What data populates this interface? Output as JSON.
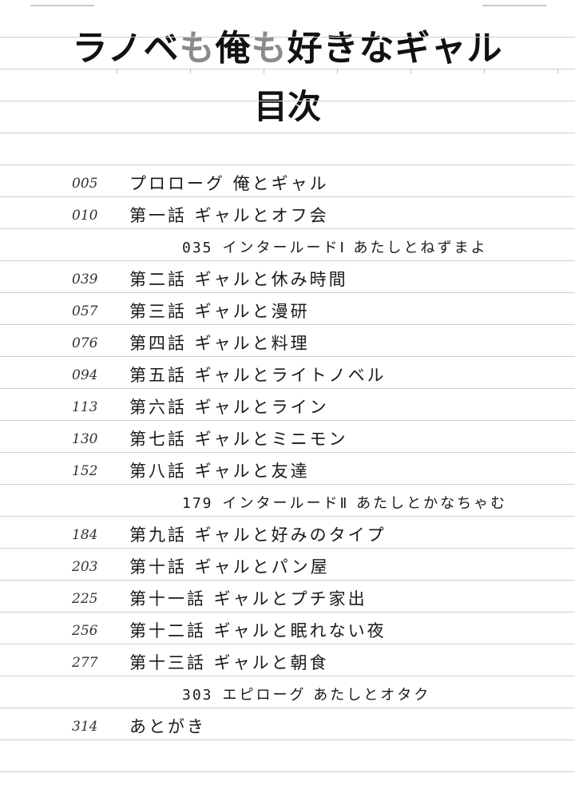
{
  "book_title": {
    "part1": "ラノベ",
    "part2": "も",
    "part3": "俺",
    "part4": "も",
    "part5": "好きなギャル"
  },
  "toc_heading": "目次",
  "entries": [
    {
      "page": "005",
      "title": "プロローグ 俺とギャル"
    },
    {
      "page": "010",
      "title": "第一話 ギャルとオフ会"
    },
    {
      "page": "035",
      "title": "インタールードⅠ あたしとねずまよ",
      "interlude": true
    },
    {
      "page": "039",
      "title": "第二話 ギャルと休み時間"
    },
    {
      "page": "057",
      "title": "第三話 ギャルと漫研"
    },
    {
      "page": "076",
      "title": "第四話 ギャルと料理"
    },
    {
      "page": "094",
      "title": "第五話 ギャルとライトノベル"
    },
    {
      "page": "113",
      "title": "第六話 ギャルとライン"
    },
    {
      "page": "130",
      "title": "第七話 ギャルとミニモン"
    },
    {
      "page": "152",
      "title": "第八話 ギャルと友達"
    },
    {
      "page": "179",
      "title": "インタールードⅡ あたしとかなちゃむ",
      "interlude": true
    },
    {
      "page": "184",
      "title": "第九話 ギャルと好みのタイプ"
    },
    {
      "page": "203",
      "title": "第十話 ギャルとパン屋"
    },
    {
      "page": "225",
      "title": "第十一話 ギャルとプチ家出"
    },
    {
      "page": "256",
      "title": "第十二話 ギャルと眠れない夜"
    },
    {
      "page": "277",
      "title": "第十三話 ギャルと朝食"
    },
    {
      "page": "303",
      "title": "エピローグ あたしとオタク",
      "interlude": true
    },
    {
      "page": "314",
      "title": "あとがき"
    }
  ],
  "colors": {
    "ink": "#1a1a1a",
    "rule": "#cfcfcf",
    "title_accent": "#8a8a8a"
  }
}
